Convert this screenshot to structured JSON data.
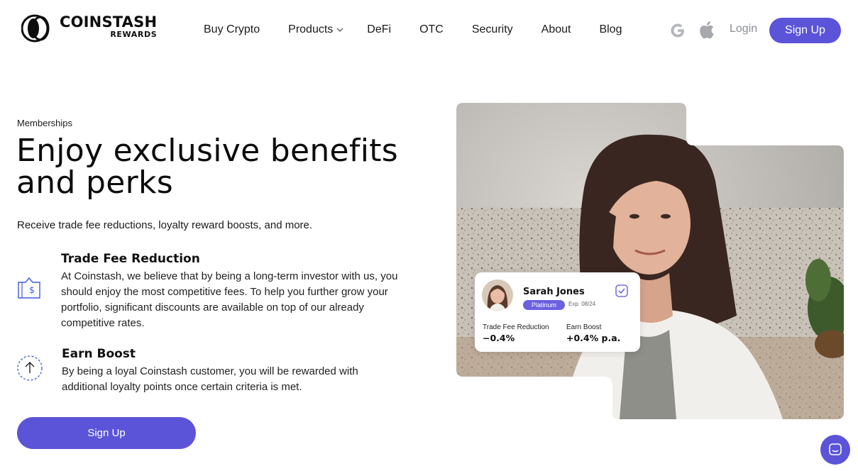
{
  "brand": {
    "name": "COINSTASH",
    "sub": "REWARDS"
  },
  "nav": {
    "links": [
      {
        "label": "Buy Crypto"
      },
      {
        "label": "Products"
      },
      {
        "label": "DeFi"
      },
      {
        "label": "OTC"
      },
      {
        "label": "Security"
      },
      {
        "label": "About"
      },
      {
        "label": "Blog"
      }
    ],
    "login_label": "Login",
    "signup_label": "Sign Up"
  },
  "hero": {
    "eyebrow": "Memberships",
    "headline_line1": "Enjoy exclusive benefits",
    "headline_line2": "and perks",
    "subtext": "Receive trade fee reductions, loyalty reward boosts, and more."
  },
  "features": [
    {
      "title": "Trade Fee Reduction",
      "body": "At Coinstash, we believe that by being a long-term investor with us, you should enjoy the most competitive fees. To help you further grow your portfolio, significant discounts are available on top of our already competitive rates.",
      "icon": "dollar-tag-icon"
    },
    {
      "title": "Earn Boost",
      "body": "By being a loyal Coinstash customer, you will be rewarded with additional loyalty points once certain criteria is met.",
      "icon": "arrow-up-circle-icon"
    }
  ],
  "cta": {
    "signup_label": "Sign Up"
  },
  "member_card": {
    "name": "Sarah Jones",
    "tier": "Platinum",
    "expiry": "Exp. 08/24",
    "stat1_label": "Trade Fee Reduction",
    "stat1_value": "−0.4%",
    "stat2_label": "Earn Boost",
    "stat2_value": "+0.4% p.a."
  },
  "colors": {
    "accent": "#5b54d8",
    "badge": "#6b60e0",
    "text": "#111111",
    "muted": "#8a8d96"
  }
}
